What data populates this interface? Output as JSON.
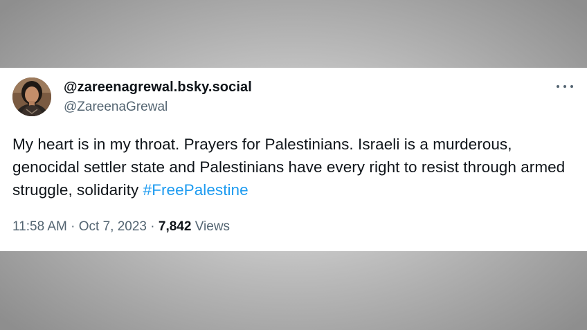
{
  "tweet": {
    "display_name": "@zareenagrewal.bsky.social",
    "handle": "@ZareenaGrewal",
    "text_main": "My heart is in my throat. Prayers for Palestinians. Israeli is a murderous, genocidal settler state and Palestinians have every right to resist through armed struggle, solidarity ",
    "hashtag": "#FreePalestine",
    "time": "11:58 AM",
    "separator": " · ",
    "date": "Oct 7, 2023",
    "views_count": "7,842",
    "views_label": " Views",
    "more_icon": "more-horizontal-icon"
  },
  "colors": {
    "text": "#0f1419",
    "secondary": "#536471",
    "link": "#1d9bf0",
    "card_bg": "#ffffff"
  }
}
